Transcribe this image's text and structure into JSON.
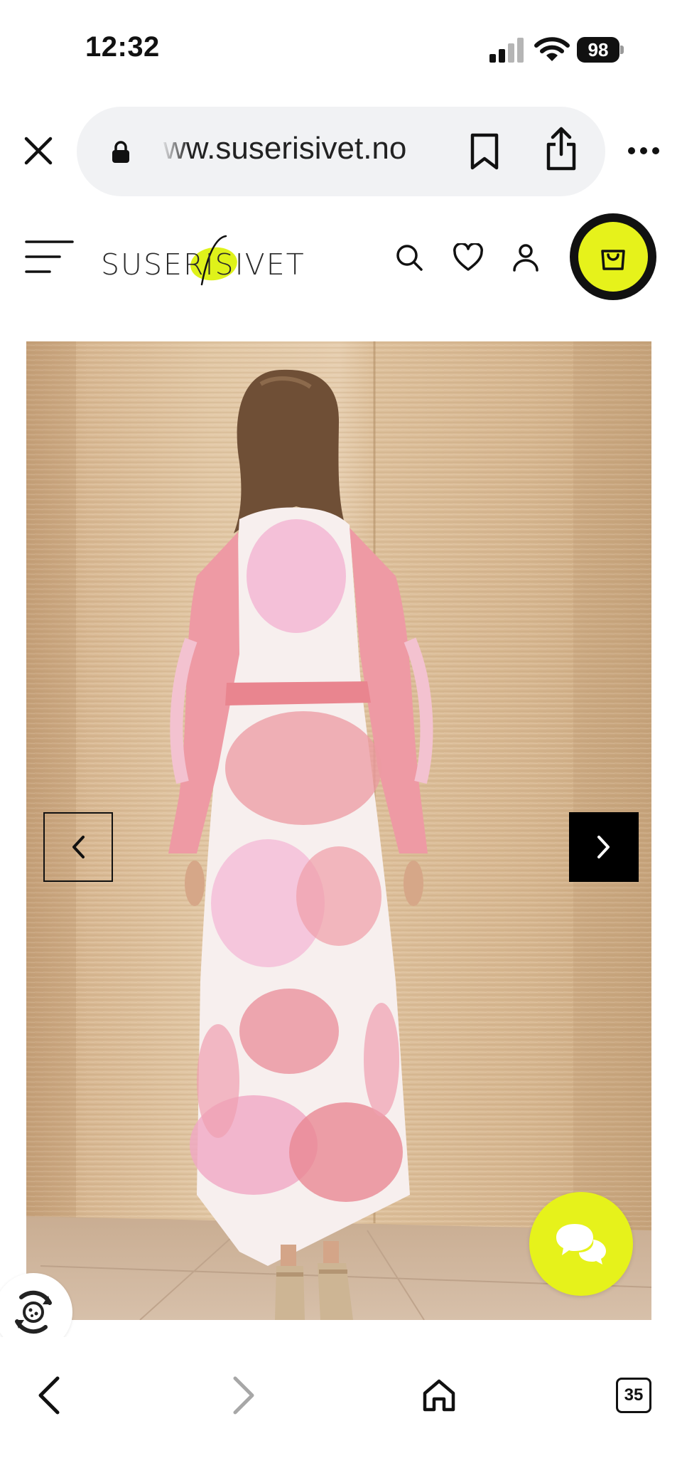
{
  "status_bar": {
    "time": "12:32",
    "battery": "98",
    "signal_icon": "cellular-signal-icon",
    "wifi_icon": "wifi-icon"
  },
  "browser": {
    "url": "ww.suserisivet.no",
    "close_icon": "close-icon",
    "lock_icon": "lock-icon",
    "bookmark_icon": "bookmark-icon",
    "share_icon": "share-icon",
    "more_icon": "more-icon"
  },
  "site": {
    "logo_text": "SUSERISIVET",
    "accent_color": "#e6f21b",
    "icons": [
      "menu-icon",
      "search-icon",
      "heart-icon",
      "user-icon",
      "shopping-bag-icon"
    ]
  },
  "gallery": {
    "prev_icon": "chevron-left-icon",
    "next_icon": "chevron-right-icon",
    "image_subject": "woman in pink paisley maxi dress, back view"
  },
  "floating": {
    "chat_icon": "chat-bubbles-icon",
    "cookie_icon": "cookie-settings-icon"
  },
  "toolbar": {
    "tabs_count": "35",
    "back_icon": "back-icon",
    "forward_icon": "forward-icon",
    "home_icon": "home-icon"
  }
}
